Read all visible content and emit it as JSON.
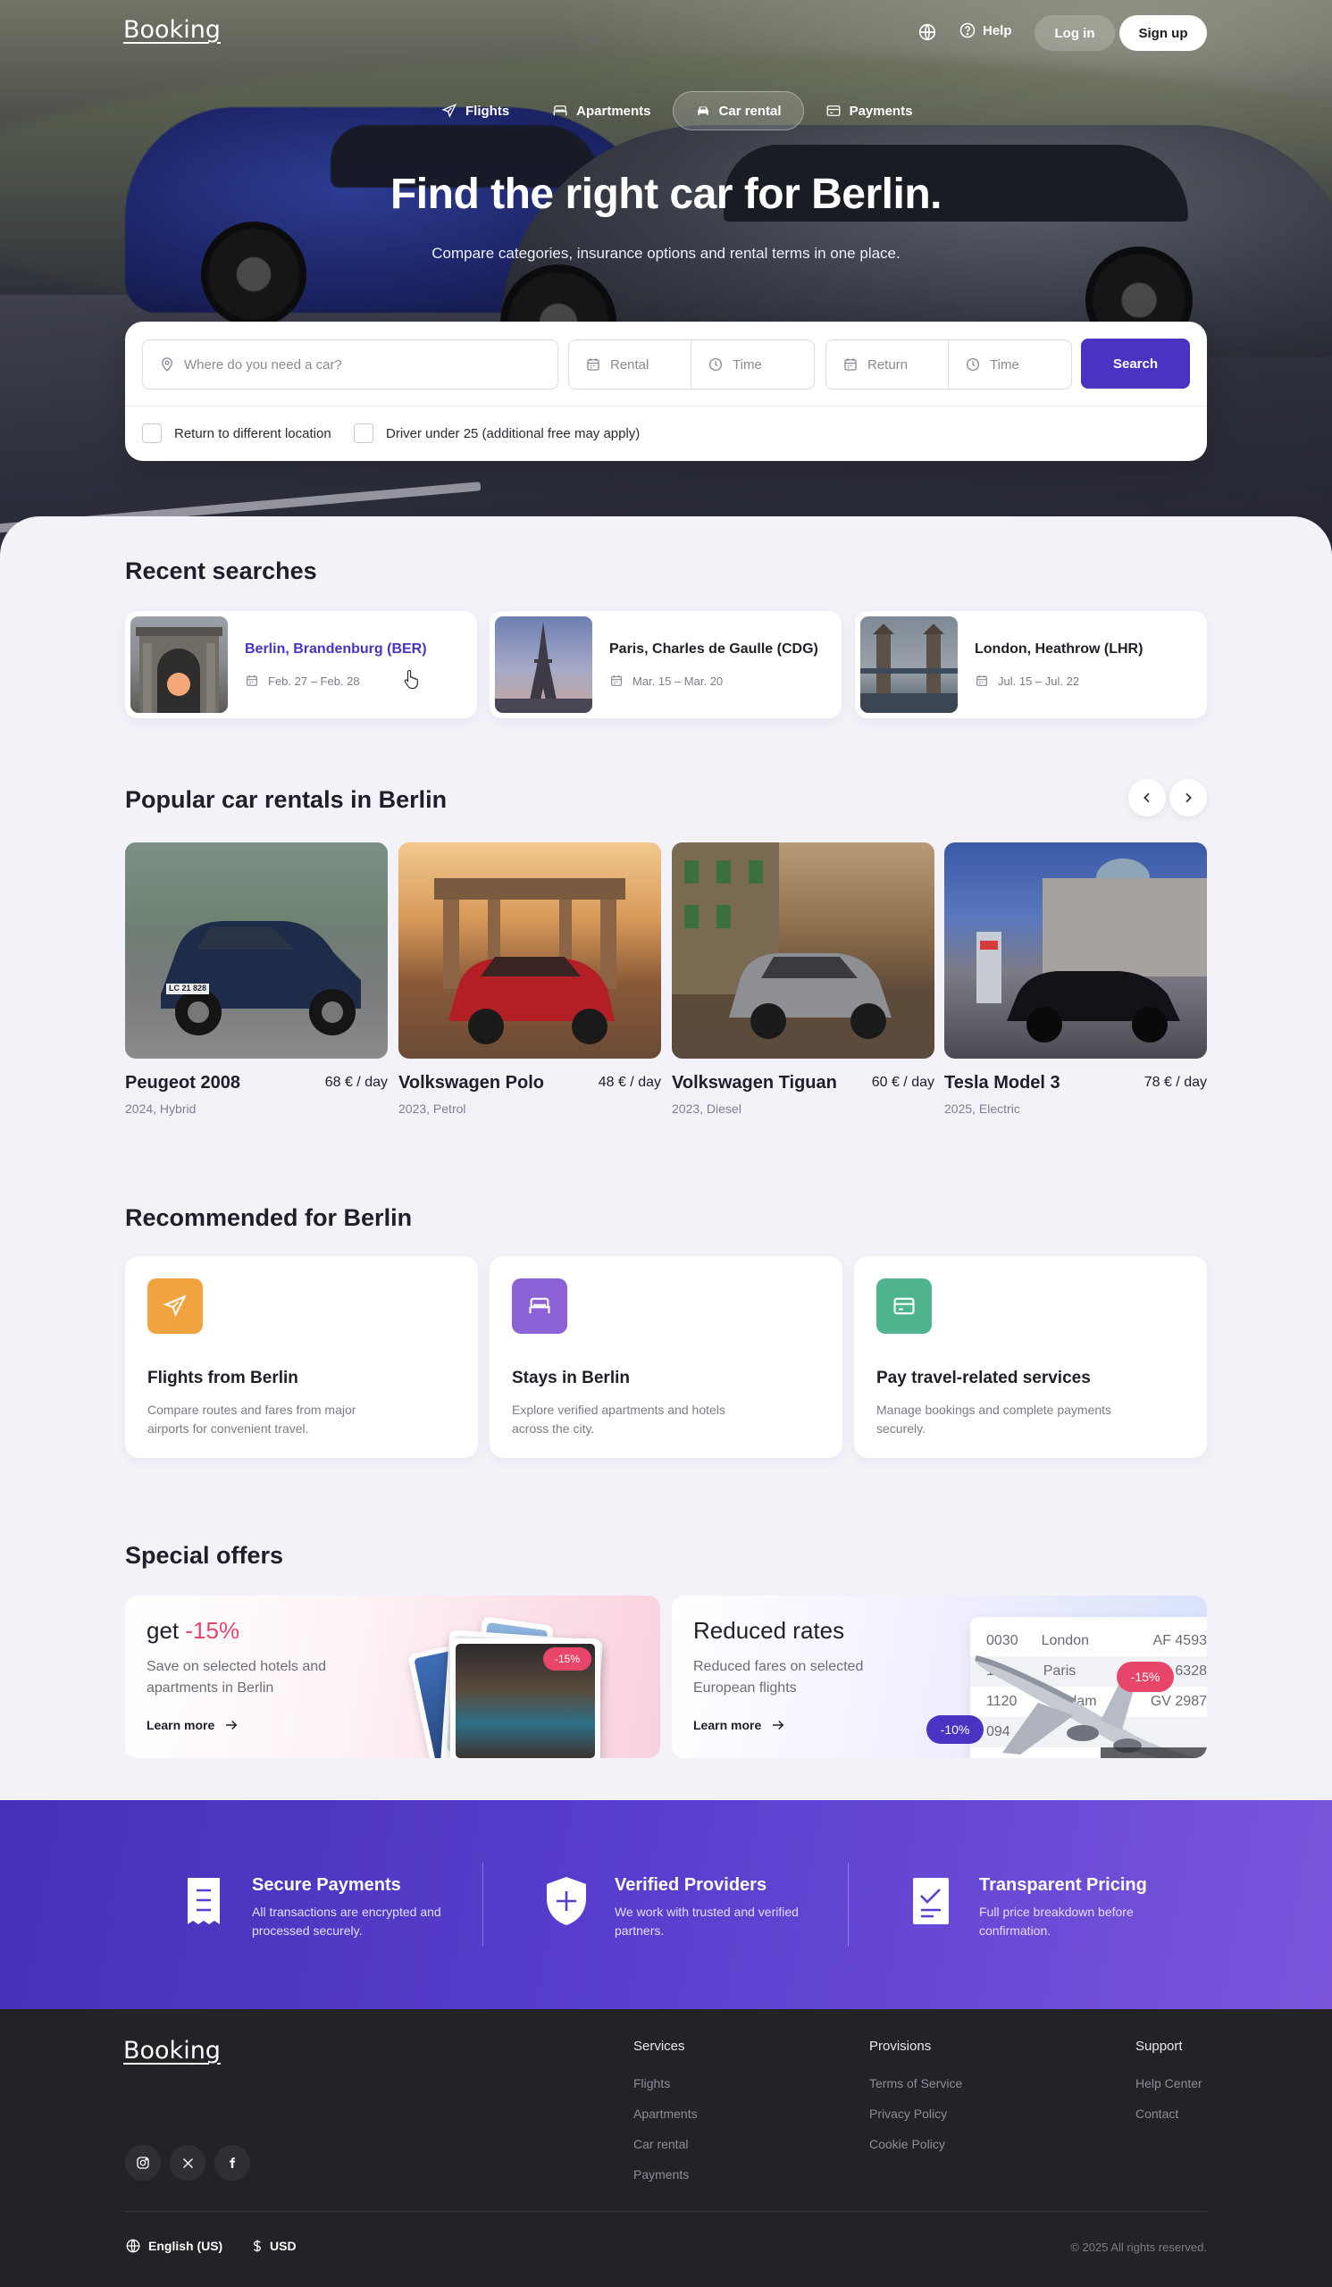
{
  "header": {
    "logo": "Booking",
    "help_label": "Help",
    "login_label": "Log in",
    "signup_label": "Sign up"
  },
  "tabs": [
    {
      "label": "Flights",
      "icon": "plane-icon"
    },
    {
      "label": "Apartments",
      "icon": "bed-icon"
    },
    {
      "label": "Car rental",
      "icon": "car-icon",
      "active": true
    },
    {
      "label": "Payments",
      "icon": "card-icon"
    }
  ],
  "hero": {
    "title": "Find the right car for Berlin.",
    "subtitle": "Compare categories, insurance options and rental terms in one place."
  },
  "search": {
    "location_placeholder": "Where do you need a car?",
    "rental_date_placeholder": "Rental",
    "rental_time_placeholder": "Time",
    "return_date_placeholder": "Return",
    "return_time_placeholder": "Time",
    "button_label": "Search",
    "option_different_location": "Return to different location",
    "option_under_25": "Driver under 25 (additional free may apply)"
  },
  "recent_searches": {
    "title": "Recent searches",
    "items": [
      {
        "name": "Berlin, Brandenburg (BER)",
        "dates": "Feb. 27 – Feb. 28"
      },
      {
        "name": "Paris, Charles de Gaulle (CDG)",
        "dates": "Mar. 15 – Mar. 20"
      },
      {
        "name": "London, Heathrow (LHR)",
        "dates": "Jul. 15 – Jul. 22"
      }
    ]
  },
  "popular": {
    "title": "Popular car rentals in Berlin",
    "cars": [
      {
        "name": "Peugeot 2008",
        "price": "68 € / day",
        "meta": "2024, Hybrid",
        "plate": "LC 21 828"
      },
      {
        "name": "Volkswagen Polo",
        "price": "48 € / day",
        "meta": "2023, Petrol"
      },
      {
        "name": "Volkswagen Tiguan",
        "price": "60 € / day",
        "meta": "2023, Diesel"
      },
      {
        "name": "Tesla Model 3",
        "price": "78 € / day",
        "meta": "2025, Electric"
      }
    ]
  },
  "recommended": {
    "title": "Recommended for Berlin",
    "items": [
      {
        "title": "Flights from Berlin",
        "desc": "Compare routes and fares from major airports for convenient travel.",
        "color": "#f0a33f"
      },
      {
        "title": "Stays in Berlin",
        "desc": "Explore verified apartments and hotels across the city.",
        "color": "#8d62d6"
      },
      {
        "title": "Pay travel-related services",
        "desc": "Manage bookings and complete payments securely.",
        "color": "#4fb58e"
      }
    ]
  },
  "offers": {
    "title": "Special offers",
    "items": [
      {
        "title_prefix": "get ",
        "title_highlight": "-15%",
        "desc": "Save on selected hotels and apartments in Berlin",
        "link": "Learn more",
        "badge": "-15%"
      },
      {
        "title": "Reduced rates",
        "desc": "Reduced fares on selected European flights",
        "link": "Learn more",
        "badge_a": "-10%",
        "badge_b": "-15%",
        "board": [
          {
            "num": "0030",
            "city": "London",
            "code": "AF 4593"
          },
          {
            "num": "14",
            "city": "Paris",
            "code": "6328"
          },
          {
            "num": "1120",
            "city": "dam",
            "code": "GV 2987"
          },
          {
            "num": "094",
            "city": "",
            "code": ""
          }
        ]
      }
    ]
  },
  "features": [
    {
      "title": "Secure Payments",
      "desc": "All transactions are encrypted and processed securely."
    },
    {
      "title": "Verified Providers",
      "desc": "We work with trusted and verified partners."
    },
    {
      "title": "Transparent Pricing",
      "desc": "Full price breakdown before confirmation."
    }
  ],
  "footer": {
    "logo": "Booking",
    "services": {
      "title": "Services",
      "links": [
        "Flights",
        "Apartments",
        "Car rental",
        "Payments"
      ]
    },
    "provisions": {
      "title": "Provisions",
      "links": [
        "Terms of Service",
        "Privacy Policy",
        "Cookie Policy"
      ]
    },
    "support": {
      "title": "Support",
      "links": [
        "Help Center",
        "Contact"
      ]
    },
    "language": "English (US)",
    "currency": "USD",
    "copyright": "© 2025 All rights reserved."
  },
  "colors": {
    "accent": "#4b32c3",
    "pink": "#e8456b",
    "footer_bg": "#222227"
  }
}
